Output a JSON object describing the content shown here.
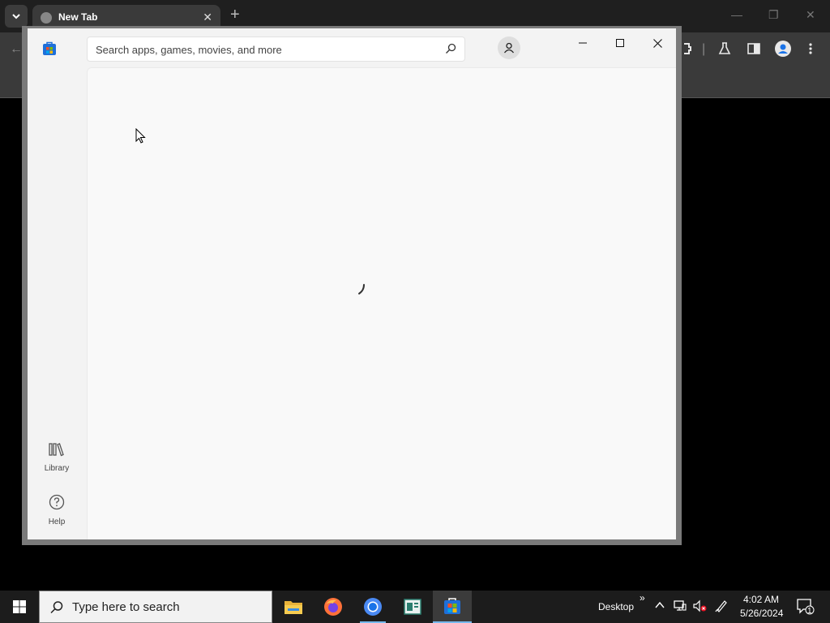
{
  "browser": {
    "tab_title": "New Tab",
    "tab_close": "✕",
    "new_tab": "+",
    "win_min": "—",
    "win_restore": "❐",
    "win_close": "✕",
    "back": "←"
  },
  "store": {
    "search_placeholder": "Search apps, games, movies, and more",
    "search_value": "",
    "sidebar": {
      "library_label": "Library",
      "help_label": "Help"
    },
    "win_min": "—",
    "win_max": "☐",
    "win_close": "✕"
  },
  "taskbar": {
    "search_text": "Type here to search",
    "desktop_label": "Desktop",
    "chevron": "»",
    "time": "4:02 AM",
    "date": "5/26/2024",
    "notifications_count": "1"
  },
  "colors": {
    "accent": "#76b9ed",
    "store_bg": "#f3f3f3"
  }
}
